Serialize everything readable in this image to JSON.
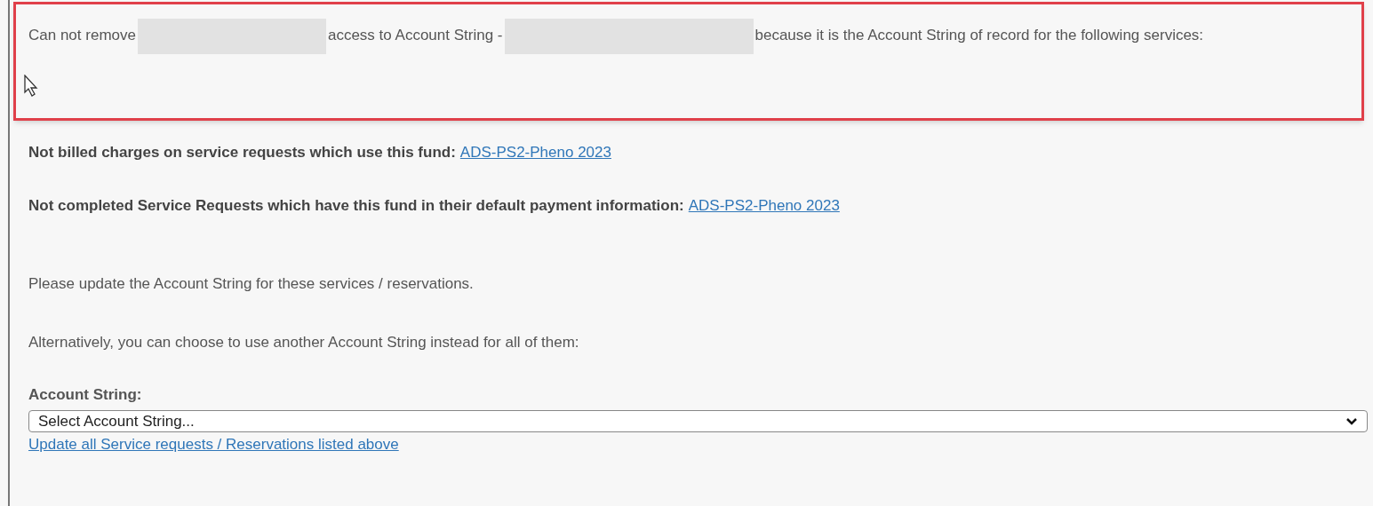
{
  "message": {
    "parts": [
      {
        "kind": "text",
        "text": "Can not remove"
      },
      {
        "kind": "redacted"
      },
      {
        "kind": "text",
        "text": "access to Account String -"
      },
      {
        "kind": "redacted"
      },
      {
        "kind": "text",
        "text": "because it is the Account String of record for the following services:"
      }
    ]
  },
  "blockers": [
    {
      "label": "Not billed charges on service requests which use this fund:",
      "link": "ADS-PS2-Pheno 2023"
    },
    {
      "label": "Not completed Service Requests which have this fund in their default payment information:",
      "link": "ADS-PS2-Pheno 2023"
    }
  ],
  "instructions": [
    "Please update the Account String for these services / reservations.",
    "Alternatively, you can choose to use another Account String instead for all of them:"
  ],
  "account_select": {
    "label": "Account String:",
    "value": "Select Account String..."
  },
  "update_link": "Update all Service requests / Reservations listed above"
}
